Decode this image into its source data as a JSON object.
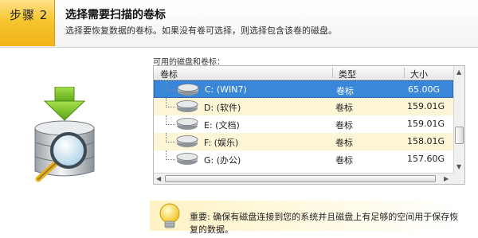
{
  "header": {
    "step_label": "步骤 2",
    "title": "选择需要扫描的卷标",
    "description": "选择要恢复数据的卷标。如果没有卷可选择，则选择包含该卷的磁盘。"
  },
  "volumes": {
    "caption": "可用的磁盘和卷标：",
    "columns": {
      "name": "卷标",
      "type": "类型",
      "size": "大小"
    },
    "rows": [
      {
        "name": "C: (WIN7)",
        "type": "卷标",
        "size": "65.00G",
        "selected": true
      },
      {
        "name": "D: (软件)",
        "type": "卷标",
        "size": "159.01G",
        "selected": false
      },
      {
        "name": "E: (文档)",
        "type": "卷标",
        "size": "159.01G",
        "selected": false
      },
      {
        "name": "F: (娱乐)",
        "type": "卷标",
        "size": "158.01G",
        "selected": false
      },
      {
        "name": "G: (办公)",
        "type": "卷标",
        "size": "157.60G",
        "selected": false
      }
    ],
    "row_icon": "disk-icon"
  },
  "note": {
    "icon": "lightbulb-icon",
    "text": "重要: 确保有磁盘连接到您的系统并且磁盘上有足够的空间用于保存恢复的数据。"
  },
  "colors": {
    "step_tab": "#f7c52e",
    "selected_row": "#3a86d8",
    "alt_row": "#fdf6d6",
    "arrow_green": "#7cc22a"
  }
}
